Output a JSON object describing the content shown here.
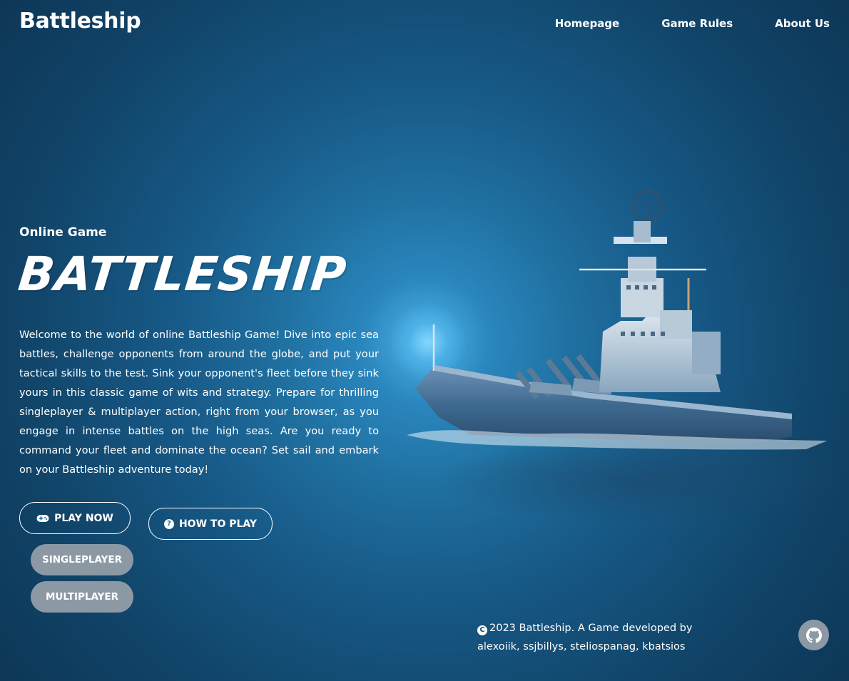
{
  "header": {
    "logo": "Battleship",
    "nav": [
      "Homepage",
      "Game Rules",
      "About Us"
    ]
  },
  "hero": {
    "subtitle": "Online Game",
    "title": "BATTLESHIP",
    "description": "Welcome to the world of online Battleship Game! Dive into epic sea battles, challenge opponents from around the globe, and put your tactical skills to the test. Sink your opponent's fleet before they sink yours in this classic game of wits and strategy. Prepare for thrilling singleplayer & multiplayer action, right from your browser, as you engage in intense battles on the high seas. Are you ready to command your fleet and dominate the ocean? Set sail and embark on your Battleship adventure today!"
  },
  "buttons": {
    "play_now": "PLAY NOW",
    "how_to_play": "HOW TO PLAY",
    "singleplayer": "SINGLEPLAYER",
    "multiplayer": "MULTIPLAYER"
  },
  "footer": {
    "copyright_symbol": "C",
    "text": "2023 Battleship. A Game developed by alexoiik, ssjbillys, steliospanag, kbatsios"
  },
  "icons": {
    "play_now": "gamepad-icon",
    "how_to_play": "question-circle-icon",
    "copyright": "copyright-icon",
    "github": "github-icon"
  },
  "colors": {
    "background_center": "#4fb6ea",
    "background_edge": "#0a2a45",
    "grey_button": "#8c99a5"
  }
}
